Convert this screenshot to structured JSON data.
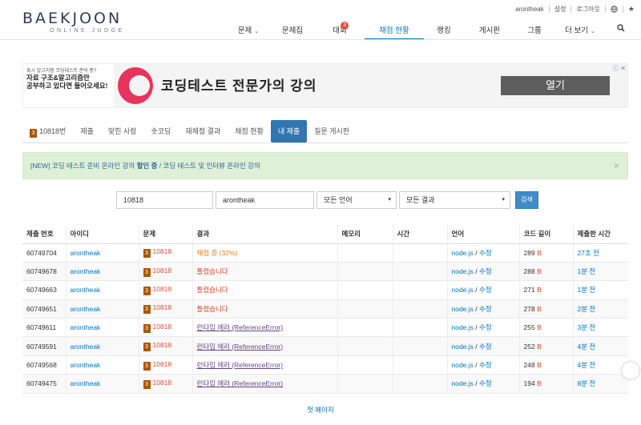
{
  "util": {
    "user": "arontheak",
    "settings": "설정",
    "logout": "로그아웃"
  },
  "logo": {
    "main": "BAEKJOON",
    "sub": "ONLINE JUDGE"
  },
  "nav": [
    {
      "label": "문제",
      "caret": true
    },
    {
      "label": "문제집"
    },
    {
      "label": "대회",
      "badge": "3"
    },
    {
      "label": "채점 현황",
      "active": true
    },
    {
      "label": "랭킹"
    },
    {
      "label": "게시판"
    },
    {
      "label": "그룹"
    },
    {
      "label": "더 보기",
      "caret": true
    }
  ],
  "ad": {
    "small_line": "혹시 알고리즘 코딩테스트 준비 중?",
    "big_line1": "자료 구조&알고리즘만",
    "big_line2": "공부하고 있다면 들어오세요!",
    "headline": "코딩테스트 전문가의 강의",
    "button": "열기"
  },
  "tabs": [
    {
      "label": "10818번",
      "badge": "3"
    },
    {
      "label": "제출"
    },
    {
      "label": "맞힌 사람"
    },
    {
      "label": "숏코딩"
    },
    {
      "label": "재채점 결과"
    },
    {
      "label": "채점 현황"
    },
    {
      "label": "내 제출",
      "active": true
    },
    {
      "label": "질문 게시판"
    }
  ],
  "notice": {
    "part1": "[NEW] 코딩 테스트 준비 온라인 강의 ",
    "part1_bold": "할인 중",
    "sep": " / ",
    "part2": "코딩 테스트 및 인터뷰 온라인 강의"
  },
  "filters": {
    "problem_id": "10818",
    "user_id": "arontheak",
    "language": "모든 언어",
    "result": "모든 결과",
    "search_button": "검색"
  },
  "table": {
    "headers": [
      "제출 번호",
      "아이디",
      "문제",
      "결과",
      "메모리",
      "시간",
      "언어",
      "코드 길이",
      "제출한 시간"
    ],
    "rows": [
      {
        "id": "60749704",
        "user": "arontheak",
        "problem": "10818",
        "result": "채점 중 (32%)",
        "rtype": "wait",
        "memory": "",
        "time": "",
        "lang": "node.js",
        "edit": "수정",
        "len": "289",
        "unit": "B",
        "when": "27초 전"
      },
      {
        "id": "60749678",
        "user": "arontheak",
        "problem": "10818",
        "result": "틀렸습니다",
        "rtype": "wrong",
        "memory": "",
        "time": "",
        "lang": "node.js",
        "edit": "수정",
        "len": "288",
        "unit": "B",
        "when": "1분 전"
      },
      {
        "id": "60749663",
        "user": "arontheak",
        "problem": "10818",
        "result": "틀렸습니다",
        "rtype": "wrong",
        "memory": "",
        "time": "",
        "lang": "node.js",
        "edit": "수정",
        "len": "271",
        "unit": "B",
        "when": "1분 전"
      },
      {
        "id": "60749651",
        "user": "arontheak",
        "problem": "10818",
        "result": "틀렸습니다",
        "rtype": "wrong",
        "memory": "",
        "time": "",
        "lang": "node.js",
        "edit": "수정",
        "len": "278",
        "unit": "B",
        "when": "2분 전"
      },
      {
        "id": "60749611",
        "user": "arontheak",
        "problem": "10818",
        "result": "런타임 에러 (ReferenceError)",
        "rtype": "rte",
        "memory": "",
        "time": "",
        "lang": "node.js",
        "edit": "수정",
        "len": "255",
        "unit": "B",
        "when": "3분 전"
      },
      {
        "id": "60749591",
        "user": "arontheak",
        "problem": "10818",
        "result": "런타임 에러 (ReferenceError)",
        "rtype": "rte",
        "memory": "",
        "time": "",
        "lang": "node.js",
        "edit": "수정",
        "len": "252",
        "unit": "B",
        "when": "4분 전"
      },
      {
        "id": "60749568",
        "user": "arontheak",
        "problem": "10818",
        "result": "런타임 에러 (ReferenceError)",
        "rtype": "rte",
        "memory": "",
        "time": "",
        "lang": "node.js",
        "edit": "수정",
        "len": "248",
        "unit": "B",
        "when": "4분 전"
      },
      {
        "id": "60749475",
        "user": "arontheak",
        "problem": "10818",
        "result": "런타임 에러 (ReferenceError)",
        "rtype": "rte",
        "memory": "",
        "time": "",
        "lang": "node.js",
        "edit": "수정",
        "len": "194",
        "unit": "B",
        "when": "8분 전"
      }
    ]
  },
  "pagination": {
    "first": "첫 페이지"
  },
  "colors": {
    "accent": "#0076c0",
    "badge_bronze": "#ad5600",
    "wrong": "#dd4124",
    "wait": "#e67e22",
    "rte": "#5f4b8b"
  }
}
